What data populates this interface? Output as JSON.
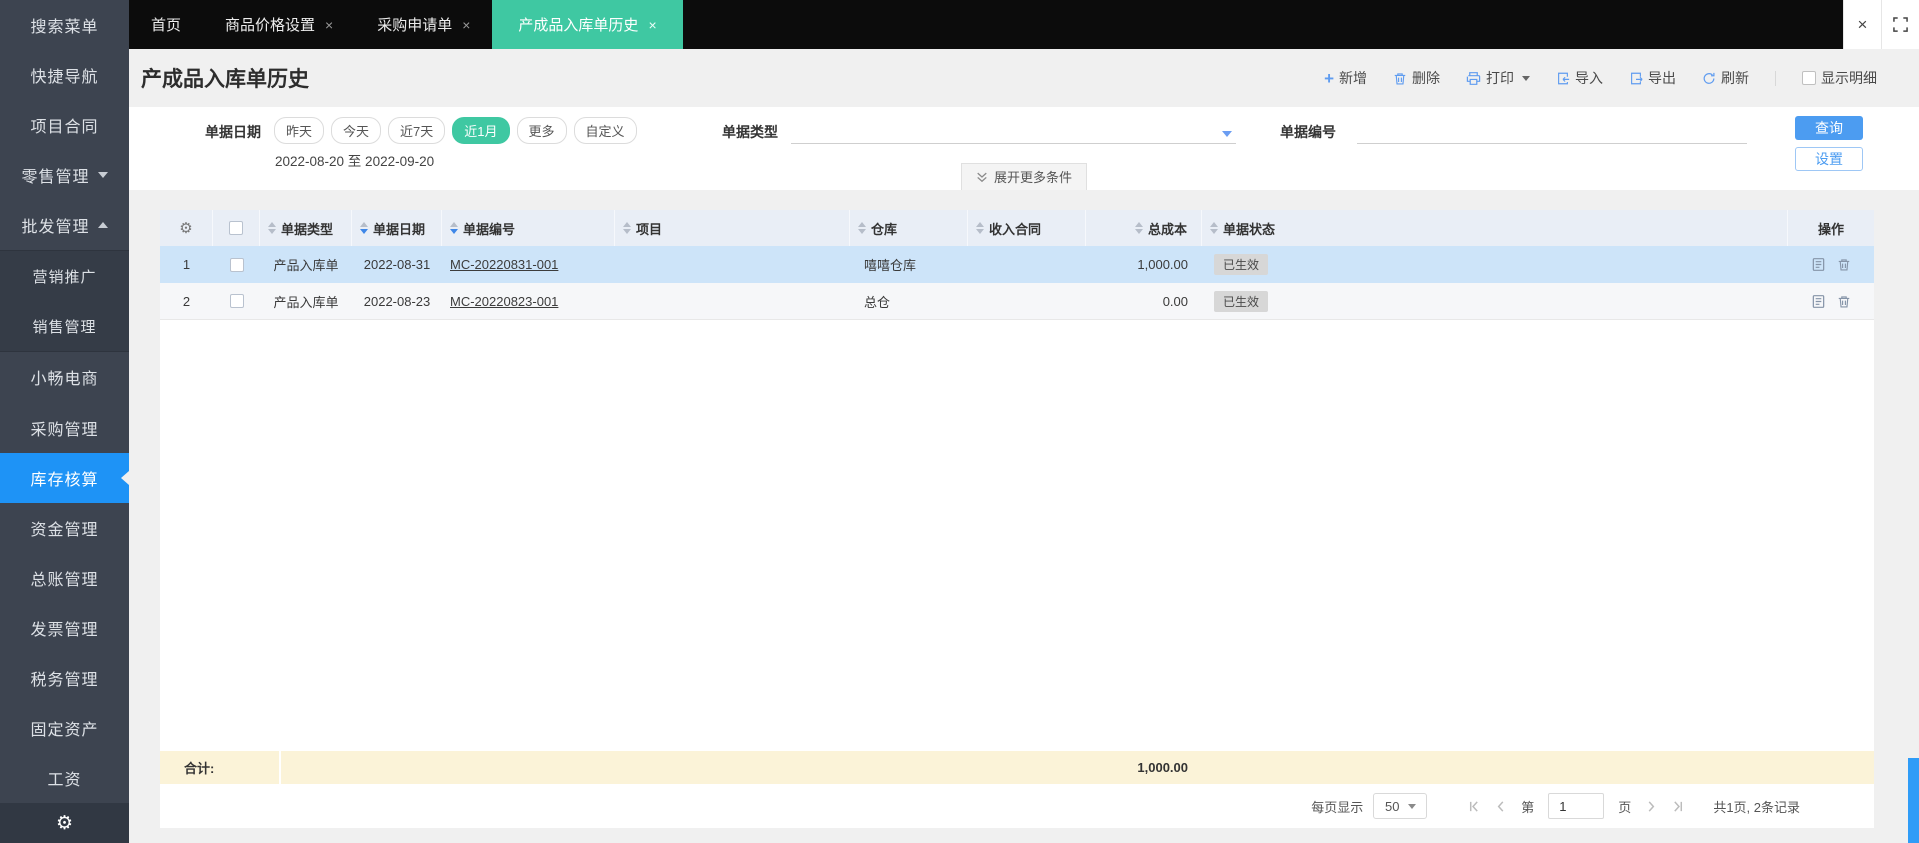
{
  "sidebar": {
    "items": [
      {
        "label": "搜索菜单"
      },
      {
        "label": "快捷导航"
      },
      {
        "label": "项目合同"
      },
      {
        "label": "零售管理"
      },
      {
        "label": "批发管理"
      },
      {
        "label": "营销推广"
      },
      {
        "label": "销售管理"
      },
      {
        "label": "小畅电商"
      },
      {
        "label": "采购管理"
      },
      {
        "label": "库存核算"
      },
      {
        "label": "资金管理"
      },
      {
        "label": "总账管理"
      },
      {
        "label": "发票管理"
      },
      {
        "label": "税务管理"
      },
      {
        "label": "固定资产"
      },
      {
        "label": "工资"
      }
    ]
  },
  "tabs": [
    {
      "label": "首页"
    },
    {
      "label": "商品价格设置"
    },
    {
      "label": "采购申请单"
    },
    {
      "label": "产成品入库单历史"
    }
  ],
  "window": {
    "close": "×"
  },
  "page": {
    "title": "产成品入库单历史"
  },
  "toolbar": {
    "add": "新增",
    "delete": "删除",
    "print": "打印",
    "import": "导入",
    "export": "导出",
    "refresh": "刷新",
    "show_detail": "显示明细"
  },
  "filters": {
    "date_label": "单据日期",
    "date_options": [
      "昨天",
      "今天",
      "近7天",
      "近1月",
      "更多",
      "自定义"
    ],
    "date_active": "近1月",
    "date_range": "2022-08-20 至 2022-09-20",
    "type_label": "单据类型",
    "number_label": "单据编号",
    "query_button": "查询",
    "settings_button": "设置",
    "expand_more": "展开更多条件"
  },
  "table": {
    "columns": [
      "单据类型",
      "单据日期",
      "单据编号",
      "项目",
      "仓库",
      "收入合同",
      "总成本",
      "单据状态"
    ],
    "action_label": "操作",
    "rows": [
      {
        "seq": "1",
        "type": "产品入库单",
        "date": "2022-08-31",
        "number": "MC-20220831-001",
        "project": "",
        "warehouse": "嘻嘻仓库",
        "contract": "",
        "cost": "1,000.00",
        "status": "已生效"
      },
      {
        "seq": "2",
        "type": "产品入库单",
        "date": "2022-08-23",
        "number": "MC-20220823-001",
        "project": "",
        "warehouse": "总仓",
        "contract": "",
        "cost": "0.00",
        "status": "已生效"
      }
    ],
    "total_label": "合计:",
    "total_value": "1,000.00"
  },
  "pagination": {
    "per_page_label": "每页显示",
    "per_page": "50",
    "page_prefix": "第",
    "page_value": "1",
    "page_suffix": "页",
    "summary": "共1页, 2条记录"
  },
  "colors": {
    "accent_blue": "#1e93f6",
    "accent_green": "#3fc8a2",
    "selected_row": "#cde4f9",
    "totals_bg": "#fbf3d8"
  }
}
